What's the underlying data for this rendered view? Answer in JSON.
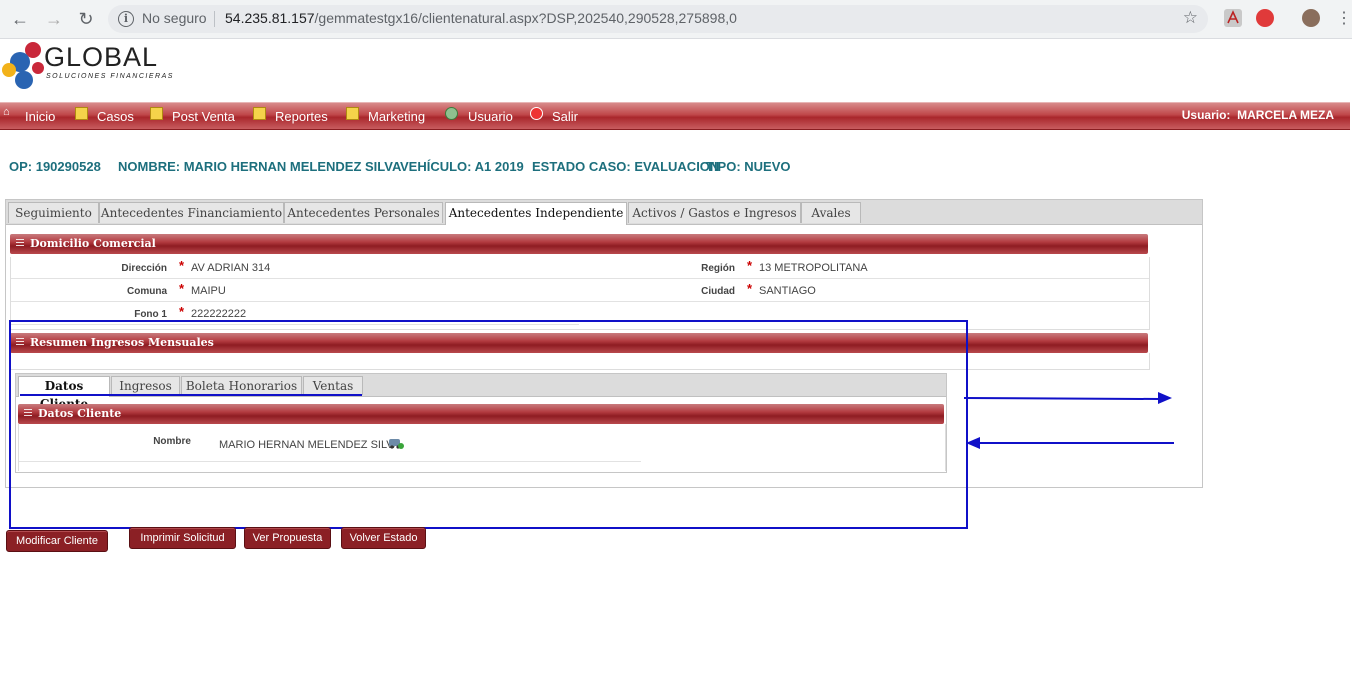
{
  "browser": {
    "not_secure": "No seguro",
    "url_host": "54.235.81.157",
    "url_path": "/gemmatestgx16/clientenatural.aspx?DSP,202540,290528,275898,0"
  },
  "logo": {
    "name": "GLOBAL",
    "subtitle": "SOLUCIONES FINANCIERAS"
  },
  "menu": {
    "items": [
      {
        "label": "Inicio"
      },
      {
        "label": "Casos"
      },
      {
        "label": "Post Venta"
      },
      {
        "label": "Reportes"
      },
      {
        "label": "Marketing"
      },
      {
        "label": "Usuario"
      },
      {
        "label": "Salir"
      }
    ],
    "user_prefix": "Usuario:",
    "user_name": "MARCELA MEZA"
  },
  "case": {
    "op": "OP: 190290528",
    "nombre": "NOMBRE: MARIO HERNAN MELENDEZ SILVA",
    "vehiculo": "VEHÍCULO: A1 2019",
    "estado": "ESTADO CASO: EVALUACION",
    "tipo": "TIPO: NUEVO"
  },
  "tabs": [
    {
      "label": "Seguimiento"
    },
    {
      "label": "Antecedentes Financiamiento"
    },
    {
      "label": "Antecedentes Personales"
    },
    {
      "label": "Antecedentes Independiente"
    },
    {
      "label": "Activos / Gastos e Ingresos"
    },
    {
      "label": "Avales"
    }
  ],
  "domicilio": {
    "title": "Domicilio Comercial",
    "direccion_label": "Dirección",
    "direccion": "AV ADRIAN 314",
    "region_label": "Región",
    "region": "13 METROPOLITANA",
    "comuna_label": "Comuna",
    "comuna": "MAIPU",
    "ciudad_label": "Ciudad",
    "ciudad": "SANTIAGO",
    "fono_label": "Fono 1",
    "fono": "222222222",
    "required_mark": "*"
  },
  "resumen": {
    "title": "Resumen Ingresos Mensuales"
  },
  "inner_tabs": [
    {
      "label": "Datos Cliente"
    },
    {
      "label": "Ingresos"
    },
    {
      "label": "Boleta Honorarios"
    },
    {
      "label": "Ventas"
    }
  ],
  "datos_cliente": {
    "title": "Datos Cliente",
    "nombre_label": "Nombre",
    "nombre": "MARIO HERNAN MELENDEZ SILVA"
  },
  "buttons": {
    "modificar": "Modificar Cliente",
    "imprimir": "Imprimir Solicitud",
    "propuesta": "Ver Propuesta",
    "volver": "Volver Estado"
  },
  "colors": {
    "accent": "#a9272c",
    "case_text": "#1d6f7d",
    "annotation": "#1010c8"
  }
}
